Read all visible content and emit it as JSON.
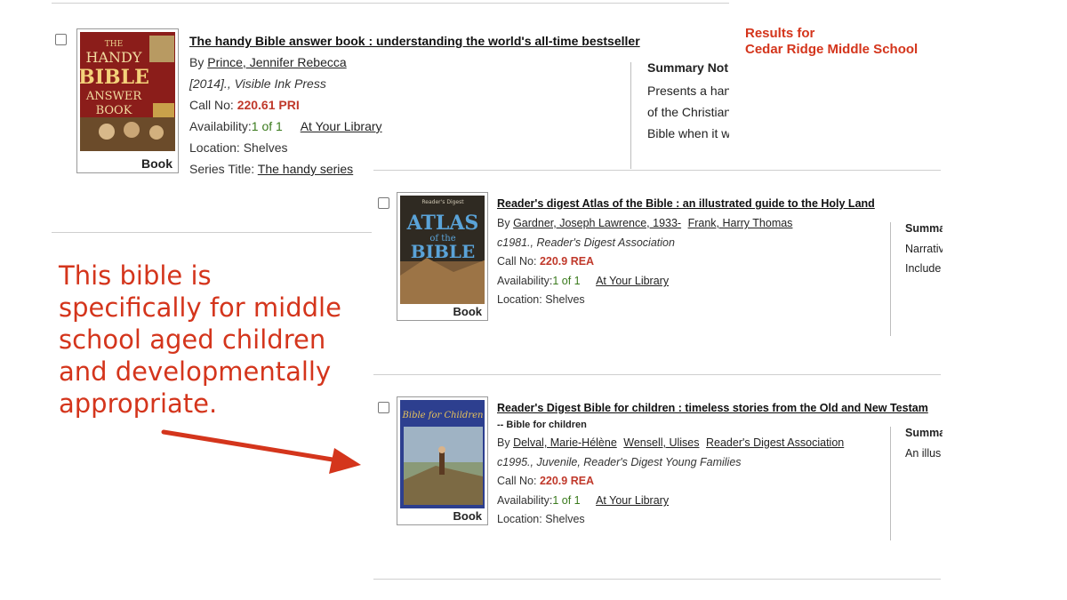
{
  "results_header": {
    "line1": "Results for",
    "line2": "Cedar Ridge Middle School"
  },
  "annotation": {
    "lines": [
      "This bible is",
      "specifically for middle",
      "school aged children",
      "and developmentally",
      "appropriate."
    ],
    "arrow": "red-arrow-right"
  },
  "colors": {
    "accent_red": "#d4351c",
    "call_no_red": "#c0392b",
    "availability_green": "#3a7a1c"
  },
  "results": [
    {
      "title": "The handy Bible answer book : understanding the world's all-time bestseller",
      "by_prefix": "By",
      "authors": [
        "Prince, Jennifer Rebecca"
      ],
      "pub": "[2014]., Visible Ink Press",
      "call_label": "Call No: ",
      "call_no": "220.61 PRI",
      "avail_label": "Availability:",
      "avail_value": "1 of 1",
      "avail_link": "At Your Library",
      "location": "Location: Shelves",
      "series_label": "Series Title: ",
      "series": "The handy series",
      "format": "Book",
      "cover_text": [
        "THE",
        "HANDY",
        "BIBLE",
        "ANSWER",
        "BOOK"
      ],
      "summary_heading": "Summary Not",
      "summary_lines": [
        "Presents a han",
        "of the Christian",
        "Bible when it w"
      ]
    },
    {
      "title": "Reader's digest Atlas of the Bible : an illustrated guide to the Holy Land",
      "by_prefix": "By",
      "authors": [
        "Gardner, Joseph Lawrence, 1933-",
        "Frank, Harry Thomas"
      ],
      "pub": "c1981., Reader's Digest Association",
      "call_label": "Call No: ",
      "call_no": "220.9 REA",
      "avail_label": "Availability:",
      "avail_value": "1 of 1",
      "avail_link": "At Your Library",
      "location": "Location: Shelves",
      "format": "Book",
      "cover_text": [
        "Reader's Digest",
        "ATLAS",
        "of the",
        "BIBLE"
      ],
      "summary_heading": "Summa",
      "summary_lines": [
        "Narrativ",
        "Include"
      ]
    },
    {
      "title": "Reader's Digest Bible for children : timeless stories from the Old and New Testam",
      "subtitle": "-- Bible for children",
      "by_prefix": "By",
      "authors": [
        "Delval, Marie-Hélène",
        "Wensell, Ulises",
        "Reader's Digest Association"
      ],
      "pub": "c1995., Juvenile, Reader's Digest Young Families",
      "call_label": "Call No: ",
      "call_no": "220.9 REA",
      "avail_label": "Availability:",
      "avail_value": "1 of 1",
      "avail_link": "At Your Library",
      "location": "Location: Shelves",
      "format": "Book",
      "cover_text": [
        "Bible for Children"
      ],
      "summary_heading": "Summa",
      "summary_lines": [
        "An illus"
      ]
    }
  ]
}
